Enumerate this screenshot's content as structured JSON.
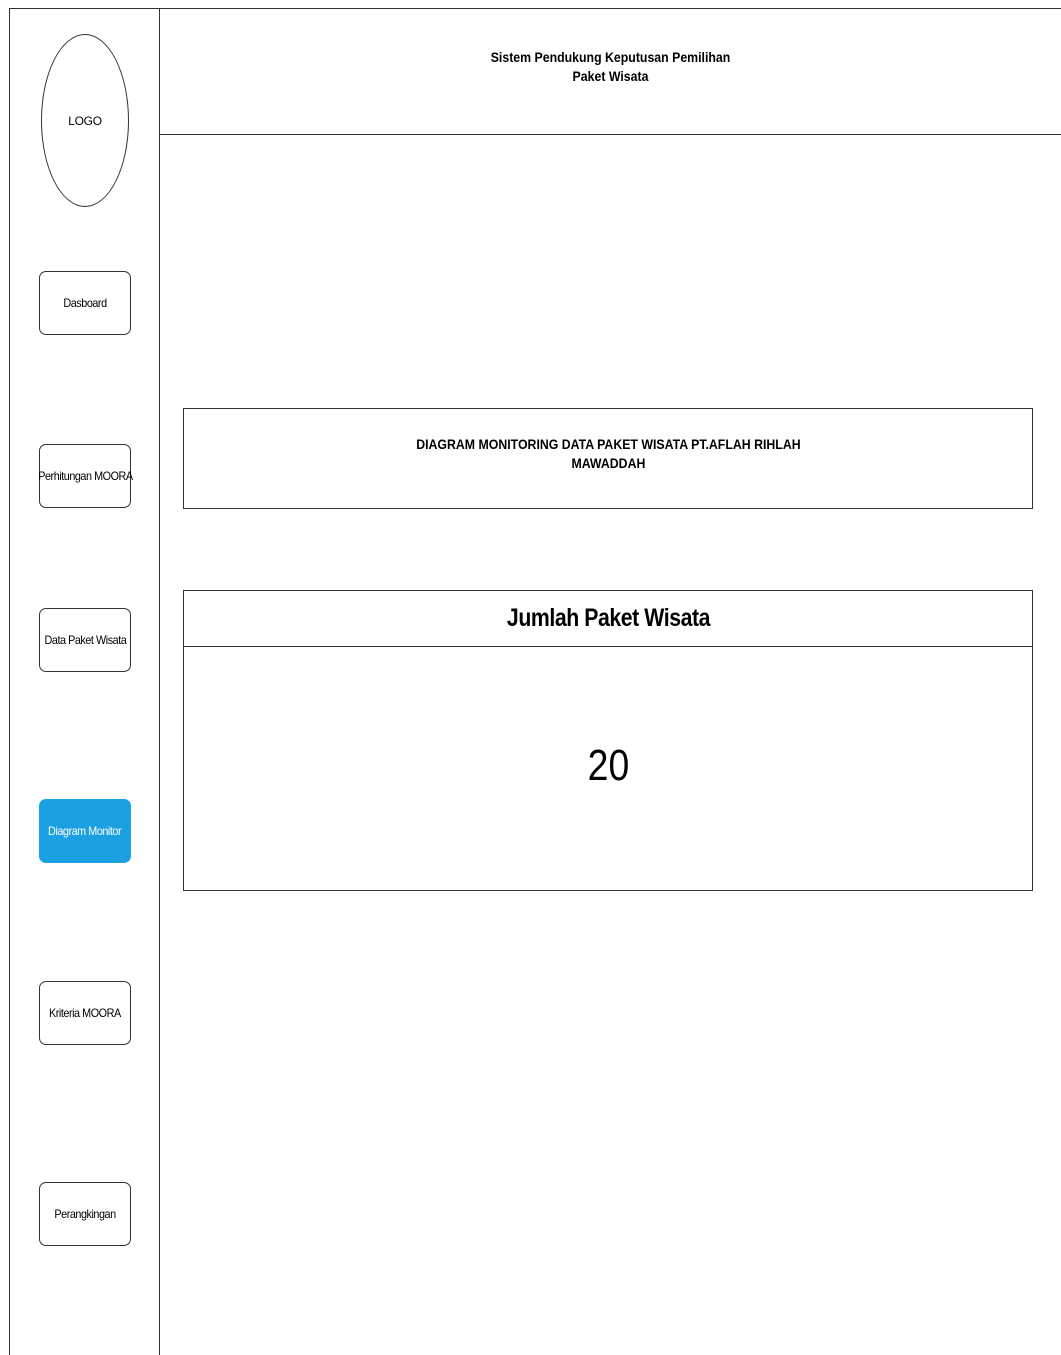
{
  "logo": {
    "label": "LOGO"
  },
  "header": {
    "title_line1": "Sistem Pendukung Keputusan Pemilihan",
    "title_line2": "Paket Wisata"
  },
  "sidebar": {
    "items": [
      {
        "label": "Dasboard",
        "active": false
      },
      {
        "label": "Perhitungan MOORA",
        "active": false
      },
      {
        "label": "Data Paket Wisata",
        "active": false
      },
      {
        "label": "Diagram Monitor",
        "active": true
      },
      {
        "label": "Kriteria MOORA",
        "active": false
      },
      {
        "label": "Perangkingan",
        "active": false
      }
    ]
  },
  "main": {
    "diagram_title_line1": "DIAGRAM MONITORING DATA PAKET WISATA PT.AFLAH RIHLAH",
    "diagram_title_line2": "MAWADDAH",
    "stat_card": {
      "label": "Jumlah Paket Wisata",
      "value": "20"
    }
  },
  "colors": {
    "active_nav": "#1ba1e2",
    "border": "#333333"
  }
}
